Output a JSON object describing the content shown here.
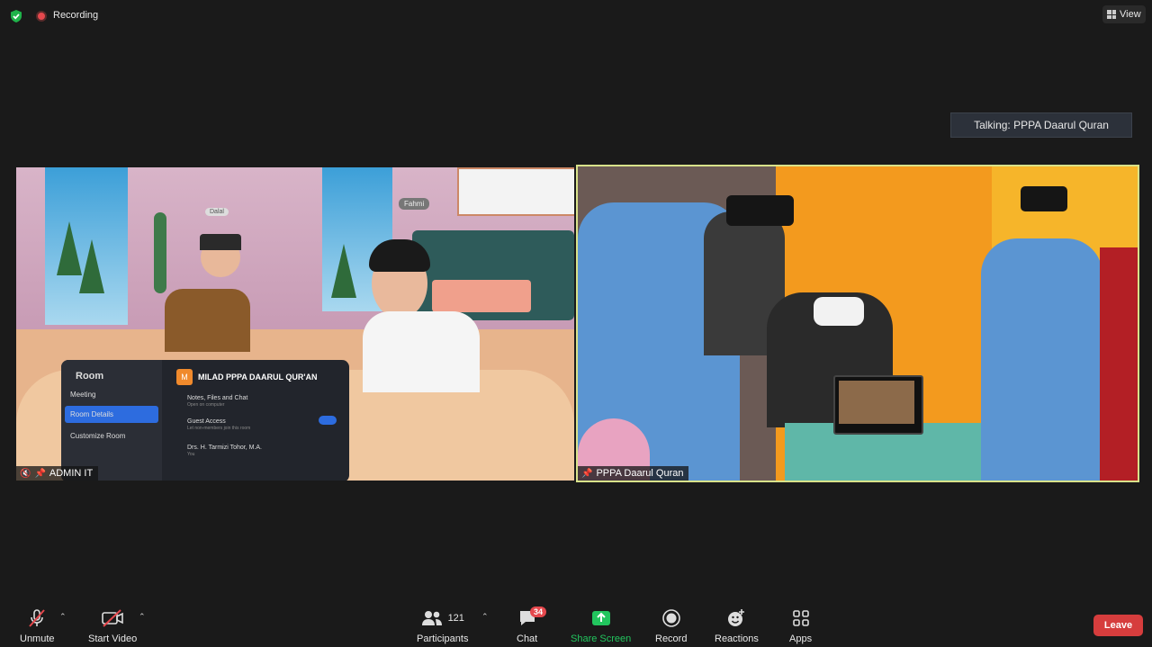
{
  "topbar": {
    "recording_label": "Recording",
    "view_label": "View"
  },
  "talking_indicator": "Talking: PPPA Daarul Quran",
  "tiles": {
    "left": {
      "name": "ADMIN IT",
      "avatar_tags": [
        "Dalal",
        "Fahmi"
      ],
      "room_panel": {
        "heading": "Room",
        "menu": [
          "Meeting",
          "Room Details",
          "Customize Room"
        ],
        "title": "MILAD PPPA DAARUL QUR'AN",
        "rows": [
          {
            "label": "Notes, Files and Chat",
            "sub": "Open on computer"
          },
          {
            "label": "Guest Access",
            "sub": "Let non-members join this room"
          },
          {
            "label": "Drs. H. Tarmizi Tohor, M.A.",
            "sub": "You"
          }
        ]
      }
    },
    "right": {
      "name": "PPPA Daarul Quran"
    }
  },
  "toolbar": {
    "unmute": "Unmute",
    "start_video": "Start Video",
    "participants": "Participants",
    "participants_count": "121",
    "chat": "Chat",
    "chat_badge": "34",
    "share_screen": "Share Screen",
    "record": "Record",
    "reactions": "Reactions",
    "apps": "Apps",
    "leave": "Leave"
  },
  "colors": {
    "background": "#1a1a1a",
    "share_green": "#22c55e",
    "leave_red": "#d63d3d",
    "active_speaker_border": "#d8e28a",
    "recording_red": "#e5484d"
  }
}
